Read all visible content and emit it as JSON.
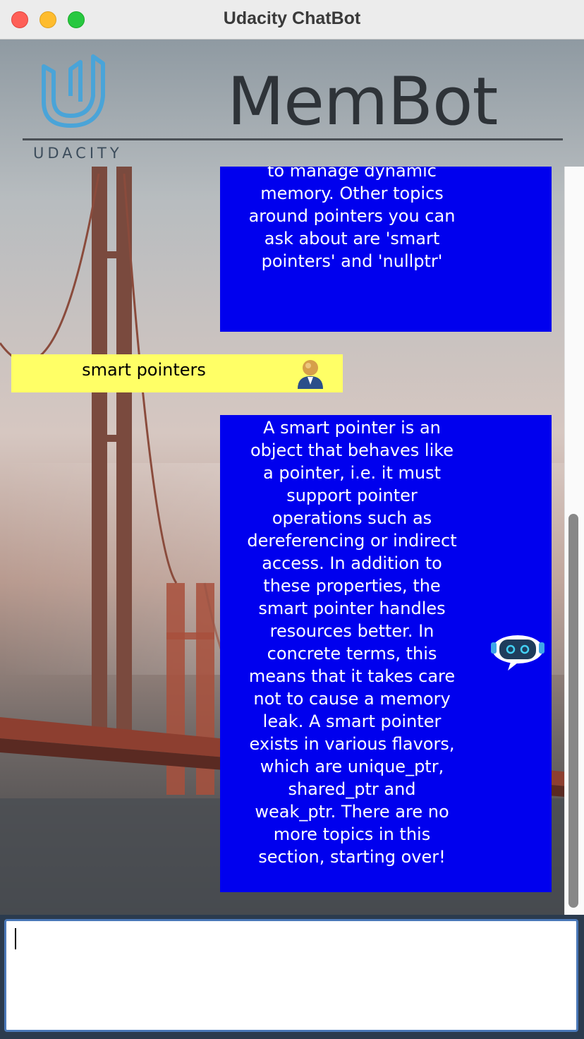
{
  "window": {
    "title": "Udacity ChatBot"
  },
  "header": {
    "logo_text": "UDACITY",
    "title": "MemBot"
  },
  "messages": [
    {
      "sender": "bot",
      "text": "code. Among other things, pointers are used to manage dynamic memory. Other topics around pointers you can ask about are 'smart pointers' and 'nullptr'"
    },
    {
      "sender": "user",
      "text": "smart pointers"
    },
    {
      "sender": "bot",
      "text": "A smart pointer is an object that behaves like a pointer, i.e. it must support pointer operations such as dereferencing or indirect access. In addition to these properties, the smart pointer handles resources better. In concrete terms, this means that it takes care not to cause a memory leak. A smart pointer exists in various flavors, which are unique_ptr, shared_ptr and weak_ptr. There are no more topics in this section, starting over!"
    }
  ],
  "input": {
    "value": ""
  },
  "colors": {
    "bot_bubble": "#0000ee",
    "user_bubble": "#ffff66",
    "bubble_text_bot": "#ffffff"
  },
  "icons": {
    "user_avatar": "user-avatar-icon",
    "bot_avatar": "robot-avatar-icon",
    "logo": "udacity-logo-icon"
  }
}
